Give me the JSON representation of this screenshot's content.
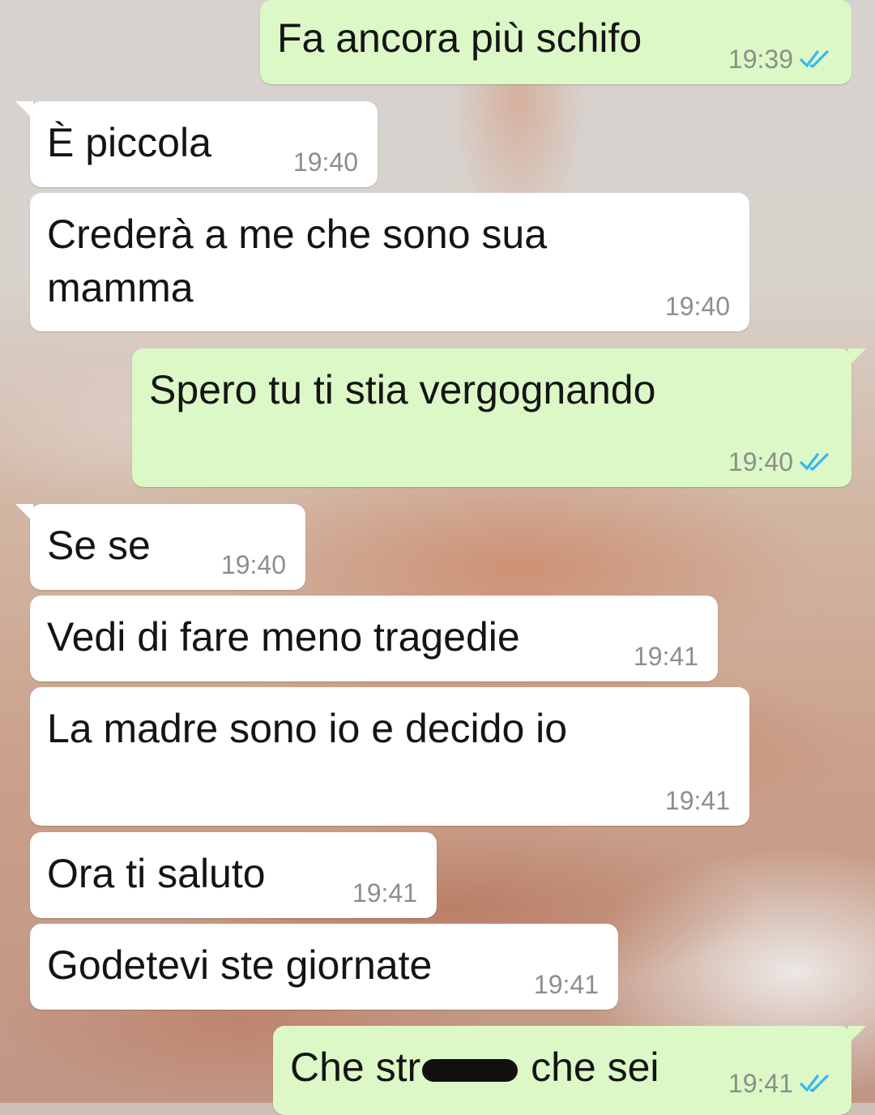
{
  "messages": [
    {
      "direction": "out",
      "text": "Fa ancora più schifo",
      "time": "19:39",
      "status": "double-check-read"
    },
    {
      "direction": "in",
      "text": "È piccola",
      "time": "19:40"
    },
    {
      "direction": "in",
      "text": "Crederà a me che sono sua\nmamma",
      "time": "19:40"
    },
    {
      "direction": "out",
      "text": "Spero tu ti stia vergognando",
      "time": "19:40",
      "status": "double-check-read"
    },
    {
      "direction": "in",
      "text": "Se se",
      "time": "19:40"
    },
    {
      "direction": "in",
      "text": "Vedi di fare meno tragedie",
      "time": "19:41"
    },
    {
      "direction": "in",
      "text": "La madre sono io e decido io",
      "time": "19:41"
    },
    {
      "direction": "in",
      "text": "Ora ti saluto",
      "time": "19:41"
    },
    {
      "direction": "in",
      "text": "Godetevi ste giornate",
      "time": "19:41"
    },
    {
      "direction": "out",
      "text_before_redaction": "Che str",
      "text_after_redaction": "che sei",
      "time": "19:41",
      "status": "double-check-read"
    }
  ],
  "colors": {
    "incoming_bubble": "#ffffff",
    "outgoing_bubble": "#dcf8c6",
    "read_ticks": "#34b7f1",
    "timestamp": "#8a8f8a"
  },
  "icons": {
    "read_receipt": "double-check-icon"
  }
}
